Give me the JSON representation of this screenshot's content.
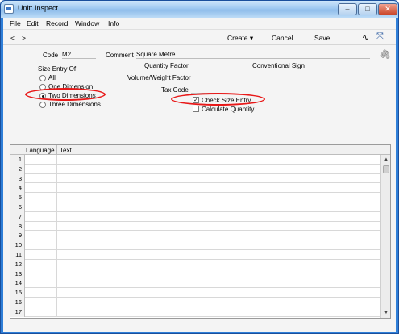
{
  "window": {
    "title": "Unit: Inspect",
    "controls": [
      "–",
      "□",
      "✕"
    ]
  },
  "menubar": [
    "File",
    "Edit",
    "Record",
    "Window",
    "Info"
  ],
  "toolbar": {
    "prev": "<",
    "next": ">",
    "create": "Create",
    "cancel": "Cancel",
    "save": "Save"
  },
  "form": {
    "code_label": "Code",
    "code_value": "M2",
    "comment_label": "Comment",
    "comment_value": "Square Metre",
    "size_entry_label": "Size Entry Of",
    "size_options": [
      "All",
      "One Dimension",
      "Two Dimensions",
      "Three Dimensions"
    ],
    "size_selected": "Two Dimensions",
    "quantity_factor_label": "Quantity Factor",
    "volume_weight_label": "Volume/Weight Factor",
    "conventional_sign_label": "Conventional Sign",
    "tax_code_label": "Tax Code",
    "check_size_entry_label": "Check Size Entry",
    "check_size_entry_checked": true,
    "calculate_quantity_label": "Calculate Quantity",
    "calculate_quantity_checked": false
  },
  "grid": {
    "columns": [
      "Language",
      "Text"
    ],
    "row_numbers": [
      "1",
      "2",
      "3",
      "4",
      "5",
      "6",
      "7",
      "8",
      "9",
      "10",
      "11",
      "12",
      "13",
      "14",
      "15",
      "16",
      "17"
    ]
  },
  "colors": {
    "highlight": "#e81818",
    "titlebar": "#9fc9f1"
  }
}
